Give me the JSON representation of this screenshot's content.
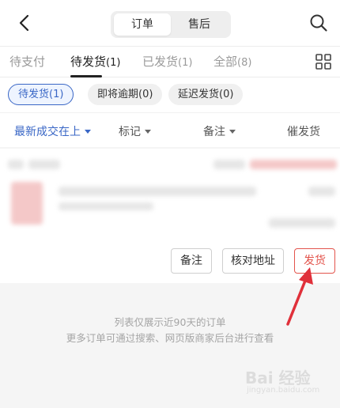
{
  "header": {
    "segments": [
      {
        "label": "订单",
        "active": true
      },
      {
        "label": "售后",
        "active": false
      }
    ],
    "icons": {
      "back": "chevron-left-icon",
      "search": "search-icon"
    }
  },
  "tabs": [
    {
      "label": "待支付",
      "count": ""
    },
    {
      "label": "待发货",
      "count": "(1)",
      "active": true
    },
    {
      "label": "已发货",
      "count": "(1)"
    },
    {
      "label": "全部",
      "count": "(8)"
    }
  ],
  "chips": [
    {
      "label": "待发货(1)",
      "active": true
    },
    {
      "label": "即将逾期(0)"
    },
    {
      "label": "延迟发货(0)"
    }
  ],
  "filters": [
    {
      "label": "最新成交在上",
      "dropdown": true,
      "accent": true
    },
    {
      "label": "标记",
      "dropdown": true
    },
    {
      "label": "备注",
      "dropdown": true
    },
    {
      "label": "催发货",
      "dropdown": false
    }
  ],
  "order_card": {
    "buttons": {
      "remark": "备注",
      "verify_address": "核对地址",
      "ship": "发货"
    }
  },
  "footer_note": {
    "line1": "列表仅展示近90天的订单",
    "line2": "更多订单可通过搜索、网页版商家后台进行查看"
  },
  "watermark": {
    "brand": "Bai 经验",
    "url": "jingyan.baidu.com"
  },
  "colors": {
    "accent": "#3a67c6",
    "ship": "#e3544c",
    "arrow": "#e0303a"
  }
}
